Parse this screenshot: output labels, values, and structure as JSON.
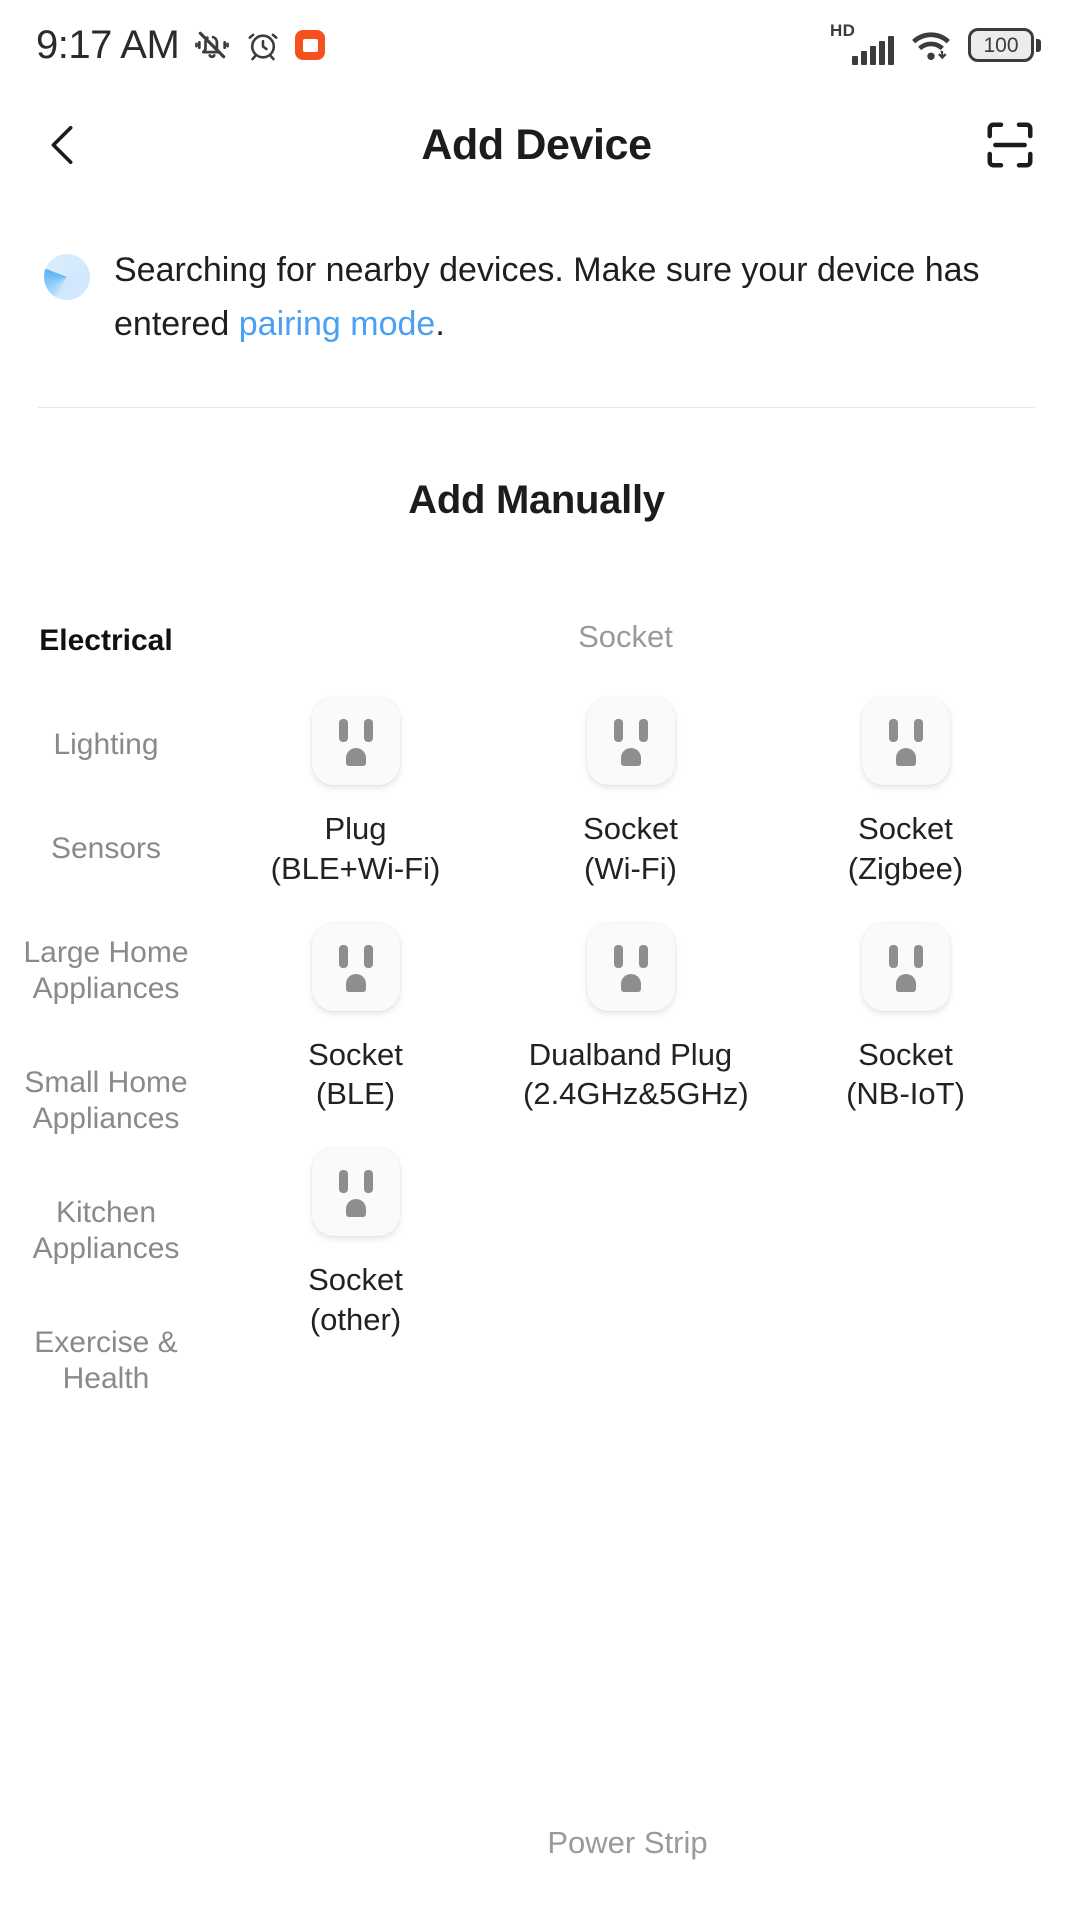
{
  "status_bar": {
    "time": "9:17 AM",
    "icons_left": [
      "vibrate-off-icon",
      "alarm-icon",
      "screen-recording-icon"
    ],
    "network_label": "HD",
    "signal_bars": 5,
    "wifi": "wifi-icon",
    "battery_percent": "100",
    "accent_record": "#f4511e"
  },
  "app_bar": {
    "back": "back-icon",
    "title": "Add Device",
    "scan": "scan-icon"
  },
  "notice": {
    "line1": "Searching for nearby devices. Make sure your device has",
    "line2_prefix": "entered ",
    "link": "pairing mode",
    "line2_suffix": ".",
    "link_color": "#4ba0f2"
  },
  "add_manually_title": "Add Manually",
  "sidebar": {
    "items": [
      {
        "label": "Electrical",
        "active": true
      },
      {
        "label": "Lighting",
        "active": false
      },
      {
        "label": "Sensors",
        "active": false
      },
      {
        "label": "Large Home\nAppliances",
        "active": false
      },
      {
        "label": "Small Home\nAppliances",
        "active": false
      },
      {
        "label": "Kitchen\nAppliances",
        "active": false
      },
      {
        "label": "Exercise &\nHealth",
        "active": false
      }
    ]
  },
  "panel": {
    "group_title": "Socket",
    "items": [
      {
        "label": "Plug\n(BLE+Wi-Fi)",
        "icon": "socket-icon"
      },
      {
        "label": "Socket\n(Wi-Fi)",
        "icon": "socket-icon"
      },
      {
        "label": "Socket\n(Zigbee)",
        "icon": "socket-icon"
      },
      {
        "label": "Socket\n(BLE)",
        "icon": "socket-icon"
      },
      {
        "label": "Dualband Plug\n(2.4GHz&5GHz)",
        "icon": "socket-icon"
      },
      {
        "label": "Socket\n(NB-IoT)",
        "icon": "socket-icon"
      },
      {
        "label": "Socket\n(other)",
        "icon": "socket-icon"
      }
    ],
    "next_group_title": "Power Strip"
  }
}
